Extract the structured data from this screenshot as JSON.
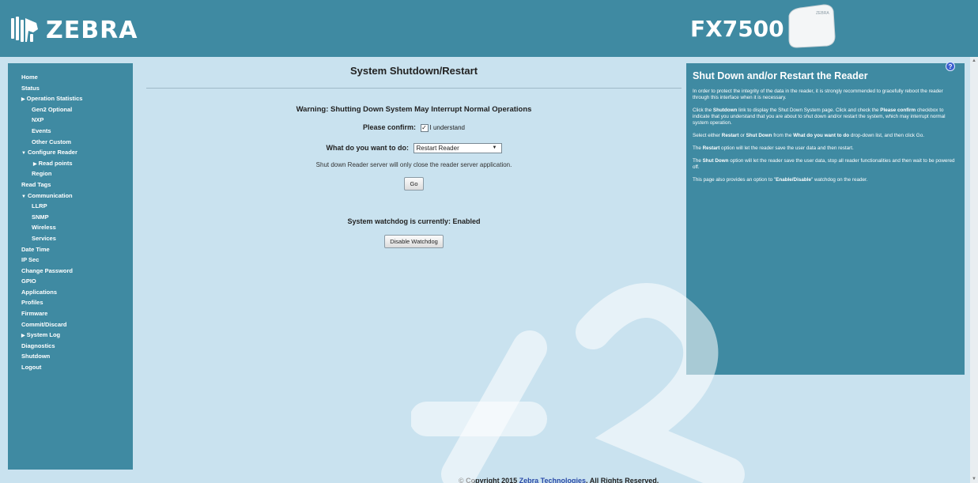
{
  "header": {
    "brand": "ZEBRA",
    "model": "FX7500",
    "device_label": "ZEBRA"
  },
  "sidebar": {
    "items": [
      {
        "label": "Home",
        "level": 0,
        "caret": ""
      },
      {
        "label": "Status",
        "level": 0,
        "caret": ""
      },
      {
        "label": "Operation Statistics",
        "level": 0,
        "caret": "▶"
      },
      {
        "label": "Gen2 Optional",
        "level": 1,
        "caret": ""
      },
      {
        "label": "NXP",
        "level": 1,
        "caret": ""
      },
      {
        "label": "Events",
        "level": 1,
        "caret": ""
      },
      {
        "label": "Other Custom",
        "level": 1,
        "caret": ""
      },
      {
        "label": "Configure Reader",
        "level": 0,
        "caret": "▼"
      },
      {
        "label": "Read points",
        "level": 2,
        "caret": "▶"
      },
      {
        "label": "Region",
        "level": 1,
        "caret": ""
      },
      {
        "label": "Read Tags",
        "level": 0,
        "caret": ""
      },
      {
        "label": "Communication",
        "level": 0,
        "caret": "▼"
      },
      {
        "label": "LLRP",
        "level": 1,
        "caret": ""
      },
      {
        "label": "SNMP",
        "level": 1,
        "caret": ""
      },
      {
        "label": "Wireless",
        "level": 1,
        "caret": ""
      },
      {
        "label": "Services",
        "level": 1,
        "caret": ""
      },
      {
        "label": "Date Time",
        "level": 0,
        "caret": ""
      },
      {
        "label": "IP Sec",
        "level": 0,
        "caret": ""
      },
      {
        "label": "Change Password",
        "level": 0,
        "caret": ""
      },
      {
        "label": "GPIO",
        "level": 0,
        "caret": ""
      },
      {
        "label": "Applications",
        "level": 0,
        "caret": ""
      },
      {
        "label": "Profiles",
        "level": 0,
        "caret": ""
      },
      {
        "label": "Firmware",
        "level": 0,
        "caret": ""
      },
      {
        "label": "Commit/Discard",
        "level": 0,
        "caret": ""
      },
      {
        "label": "System Log",
        "level": 0,
        "caret": "▶"
      },
      {
        "label": "Diagnostics",
        "level": 0,
        "caret": ""
      },
      {
        "label": "Shutdown",
        "level": 0,
        "caret": ""
      },
      {
        "label": "Logout",
        "level": 0,
        "caret": ""
      }
    ]
  },
  "main": {
    "title": "System Shutdown/Restart",
    "warning": "Warning: Shutting Down System May Interrupt Normal Operations",
    "confirm_label": "Please confirm:",
    "confirm_checked": true,
    "confirm_text": "I understand",
    "action_label": "What do you want to do:",
    "action_value": "Restart Reader",
    "note": "Shut down Reader server will only close the reader server application.",
    "go_label": "Go",
    "watchdog_status": "System watchdog is currently: Enabled",
    "watchdog_button": "Disable Watchdog"
  },
  "footer": {
    "prefix": "© Copyright 2015",
    "link": "Zebra Technologies",
    "suffix": ". All Rights Reserved."
  },
  "help": {
    "title": "Shut Down and/or Restart the Reader",
    "icon": "?",
    "p1": "In order to protect the integrity of the data in the reader, it is strongly recommended to gracefully reboot the reader through this interface when it is necessary.",
    "p2_a": "Click the ",
    "p2_b": "Shutdown",
    "p2_c": " link to display the Shut Down System page. Click and check the ",
    "p2_d": "Please confirm",
    "p2_e": " checkbox to indicate that you understand that you are about to shut down and/or restart the system, which may interrupt normal system operation.",
    "p3_a": "Select either ",
    "p3_b": "Restart",
    "p3_c": " or ",
    "p3_d": "Shut Down",
    "p3_e": " from the ",
    "p3_f": "What do you want to do",
    "p3_g": " drop-down list, and then click Go.",
    "p4_a": "The ",
    "p4_b": "Restart",
    "p4_c": " option will let the reader save the user data and then restart.",
    "p5_a": "The ",
    "p5_b": "Shut Down",
    "p5_c": " option will let the reader save the user data, stop all reader functionalities and then wait to be powered off.",
    "p6_a": "This page also provides an option to \"",
    "p6_b": "Enable/Disable",
    "p6_c": "\" watchdog on the reader."
  }
}
